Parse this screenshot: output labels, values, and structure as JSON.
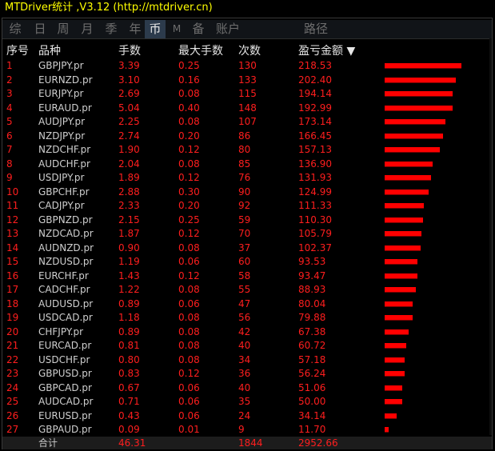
{
  "window": {
    "title": "MTDriver统计  ,V3.12 (http://mtdriver.cn)"
  },
  "tabs": [
    {
      "label": "综",
      "active": false
    },
    {
      "label": "日",
      "active": false
    },
    {
      "label": "周",
      "active": false
    },
    {
      "label": "月",
      "active": false
    },
    {
      "label": "季",
      "active": false
    },
    {
      "label": "年",
      "active": false
    },
    {
      "label": "币",
      "active": true
    },
    {
      "label": "M",
      "active": false
    },
    {
      "label": "备",
      "active": false
    },
    {
      "label": "账户",
      "active": false
    },
    {
      "label": "路径",
      "active": false
    }
  ],
  "columns": {
    "index": "序号",
    "symbol": "品种",
    "lots": "手数",
    "max_lots": "最大手数",
    "count": "次数",
    "pnl": "盈亏金额 ▼"
  },
  "colors": {
    "accent_red": "#ff1e1e",
    "bar_red": "#ff0000",
    "title_yellow": "#ffff00"
  },
  "rows": [
    {
      "index": "1",
      "symbol": "GBPJPY.pr",
      "lots": "3.39",
      "max_lots": "0.25",
      "count": "130",
      "pnl": "218.53",
      "pnl_value": 218.53
    },
    {
      "index": "2",
      "symbol": "EURNZD.pr",
      "lots": "3.10",
      "max_lots": "0.16",
      "count": "133",
      "pnl": "202.40",
      "pnl_value": 202.4
    },
    {
      "index": "3",
      "symbol": "EURJPY.pr",
      "lots": "2.69",
      "max_lots": "0.08",
      "count": "115",
      "pnl": "194.14",
      "pnl_value": 194.14
    },
    {
      "index": "4",
      "symbol": "EURAUD.pr",
      "lots": "5.04",
      "max_lots": "0.40",
      "count": "148",
      "pnl": "192.99",
      "pnl_value": 192.99
    },
    {
      "index": "5",
      "symbol": "AUDJPY.pr",
      "lots": "2.25",
      "max_lots": "0.08",
      "count": "107",
      "pnl": "173.14",
      "pnl_value": 173.14
    },
    {
      "index": "6",
      "symbol": "NZDJPY.pr",
      "lots": "2.74",
      "max_lots": "0.20",
      "count": "86",
      "pnl": "166.45",
      "pnl_value": 166.45
    },
    {
      "index": "7",
      "symbol": "NZDCHF.pr",
      "lots": "1.90",
      "max_lots": "0.12",
      "count": "80",
      "pnl": "157.13",
      "pnl_value": 157.13
    },
    {
      "index": "8",
      "symbol": "AUDCHF.pr",
      "lots": "2.04",
      "max_lots": "0.08",
      "count": "85",
      "pnl": "136.90",
      "pnl_value": 136.9
    },
    {
      "index": "9",
      "symbol": "USDJPY.pr",
      "lots": "1.89",
      "max_lots": "0.12",
      "count": "76",
      "pnl": "131.93",
      "pnl_value": 131.93
    },
    {
      "index": "10",
      "symbol": "GBPCHF.pr",
      "lots": "2.88",
      "max_lots": "0.30",
      "count": "90",
      "pnl": "124.99",
      "pnl_value": 124.99
    },
    {
      "index": "11",
      "symbol": "CADJPY.pr",
      "lots": "2.33",
      "max_lots": "0.20",
      "count": "92",
      "pnl": "111.33",
      "pnl_value": 111.33
    },
    {
      "index": "12",
      "symbol": "GBPNZD.pr",
      "lots": "2.15",
      "max_lots": "0.25",
      "count": "59",
      "pnl": "110.30",
      "pnl_value": 110.3
    },
    {
      "index": "13",
      "symbol": "NZDCAD.pr",
      "lots": "1.87",
      "max_lots": "0.12",
      "count": "70",
      "pnl": "105.79",
      "pnl_value": 105.79
    },
    {
      "index": "14",
      "symbol": "AUDNZD.pr",
      "lots": "0.90",
      "max_lots": "0.08",
      "count": "37",
      "pnl": "102.37",
      "pnl_value": 102.37
    },
    {
      "index": "15",
      "symbol": "NZDUSD.pr",
      "lots": "1.19",
      "max_lots": "0.06",
      "count": "60",
      "pnl": "93.53",
      "pnl_value": 93.53
    },
    {
      "index": "16",
      "symbol": "EURCHF.pr",
      "lots": "1.43",
      "max_lots": "0.12",
      "count": "58",
      "pnl": "93.47",
      "pnl_value": 93.47
    },
    {
      "index": "17",
      "symbol": "CADCHF.pr",
      "lots": "1.22",
      "max_lots": "0.08",
      "count": "55",
      "pnl": "88.93",
      "pnl_value": 88.93
    },
    {
      "index": "18",
      "symbol": "AUDUSD.pr",
      "lots": "0.89",
      "max_lots": "0.06",
      "count": "47",
      "pnl": "80.04",
      "pnl_value": 80.04
    },
    {
      "index": "19",
      "symbol": "USDCAD.pr",
      "lots": "1.18",
      "max_lots": "0.08",
      "count": "56",
      "pnl": "79.88",
      "pnl_value": 79.88
    },
    {
      "index": "20",
      "symbol": "CHFJPY.pr",
      "lots": "0.89",
      "max_lots": "0.08",
      "count": "42",
      "pnl": "67.38",
      "pnl_value": 67.38
    },
    {
      "index": "21",
      "symbol": "EURCAD.pr",
      "lots": "0.81",
      "max_lots": "0.08",
      "count": "40",
      "pnl": "60.72",
      "pnl_value": 60.72
    },
    {
      "index": "22",
      "symbol": "USDCHF.pr",
      "lots": "0.80",
      "max_lots": "0.08",
      "count": "34",
      "pnl": "57.18",
      "pnl_value": 57.18
    },
    {
      "index": "23",
      "symbol": "GBPUSD.pr",
      "lots": "0.83",
      "max_lots": "0.12",
      "count": "36",
      "pnl": "56.24",
      "pnl_value": 56.24
    },
    {
      "index": "24",
      "symbol": "GBPCAD.pr",
      "lots": "0.67",
      "max_lots": "0.06",
      "count": "40",
      "pnl": "51.06",
      "pnl_value": 51.06
    },
    {
      "index": "25",
      "symbol": "AUDCAD.pr",
      "lots": "0.71",
      "max_lots": "0.06",
      "count": "35",
      "pnl": "50.00",
      "pnl_value": 50.0
    },
    {
      "index": "26",
      "symbol": "EURUSD.pr",
      "lots": "0.43",
      "max_lots": "0.06",
      "count": "24",
      "pnl": "34.14",
      "pnl_value": 34.14
    },
    {
      "index": "27",
      "symbol": "GBPAUD.pr",
      "lots": "0.09",
      "max_lots": "0.01",
      "count": "9",
      "pnl": "11.70",
      "pnl_value": 11.7
    }
  ],
  "footer": {
    "label": "合计",
    "lots": "46.31",
    "count": "1844",
    "pnl": "2952.66"
  }
}
